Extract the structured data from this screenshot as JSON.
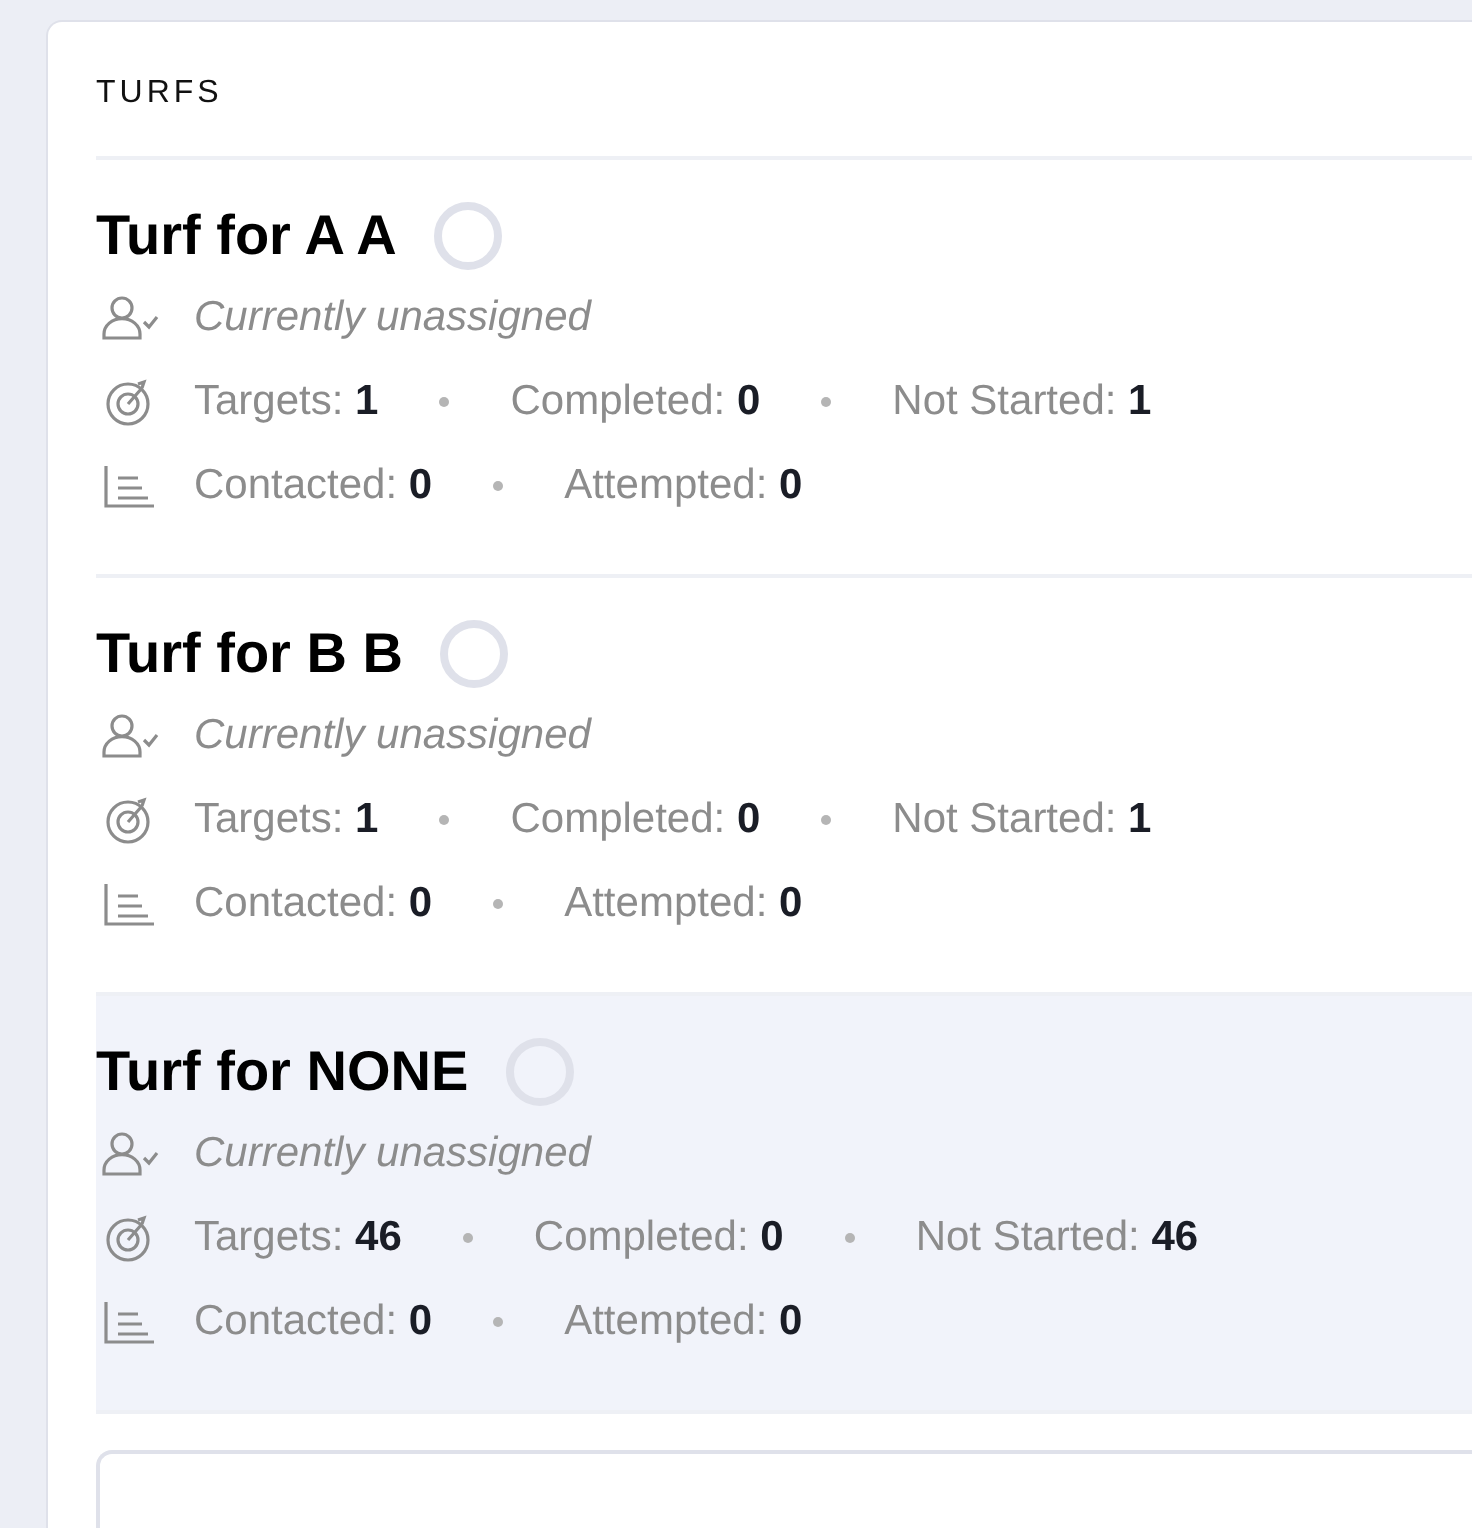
{
  "section_title": "TURFS",
  "turfs": [
    {
      "name": "Turf for A A",
      "selected": false,
      "assignee": "Currently unassigned",
      "stat_rows": [
        {
          "kind": "targets",
          "items": [
            {
              "label": "Targets:",
              "value": "1"
            },
            {
              "label": "Completed:",
              "value": "0"
            },
            {
              "label": "Not Started:",
              "value": "1"
            }
          ]
        },
        {
          "kind": "contacts",
          "items": [
            {
              "label": "Contacted:",
              "value": "0"
            },
            {
              "label": "Attempted:",
              "value": "0"
            }
          ]
        }
      ]
    },
    {
      "name": "Turf for B B",
      "selected": false,
      "assignee": "Currently unassigned",
      "stat_rows": [
        {
          "kind": "targets",
          "items": [
            {
              "label": "Targets:",
              "value": "1"
            },
            {
              "label": "Completed:",
              "value": "0"
            },
            {
              "label": "Not Started:",
              "value": "1"
            }
          ]
        },
        {
          "kind": "contacts",
          "items": [
            {
              "label": "Contacted:",
              "value": "0"
            },
            {
              "label": "Attempted:",
              "value": "0"
            }
          ]
        }
      ]
    },
    {
      "name": "Turf for NONE",
      "selected": true,
      "assignee": "Currently unassigned",
      "stat_rows": [
        {
          "kind": "targets",
          "items": [
            {
              "label": "Targets:",
              "value": "46"
            },
            {
              "label": "Completed:",
              "value": "0"
            },
            {
              "label": "Not Started:",
              "value": "46"
            }
          ]
        },
        {
          "kind": "contacts",
          "items": [
            {
              "label": "Contacted:",
              "value": "0"
            },
            {
              "label": "Attempted:",
              "value": "0"
            }
          ]
        }
      ]
    }
  ]
}
